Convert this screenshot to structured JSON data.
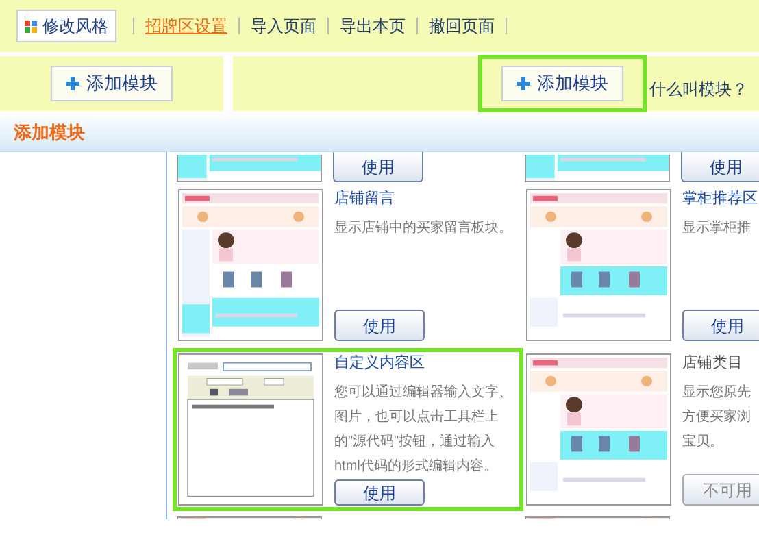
{
  "toolbar": {
    "style_button": "修改风格",
    "links": [
      {
        "label": "招牌区设置",
        "selected": true
      },
      {
        "label": "导入页面",
        "selected": false
      },
      {
        "label": "导出本页",
        "selected": false
      },
      {
        "label": "撤回页面",
        "selected": false
      }
    ]
  },
  "add_bar": {
    "buttons": [
      {
        "label": "添加模块",
        "highlighted": false
      },
      {
        "label": "添加模块",
        "highlighted": true
      }
    ],
    "help_link": "什么叫模块？"
  },
  "section_title": "添加模块",
  "previous_row": [
    {
      "kind": "shop",
      "button": {
        "label": "使用"
      }
    },
    {
      "kind": "shop",
      "button": {
        "label": "使用"
      }
    }
  ],
  "module_rows": [
    [
      {
        "title": "店铺留言",
        "description": [
          "显示店铺中的买家留言板块。"
        ],
        "kind": "shop",
        "highlighted": false,
        "button": {
          "label": "使用",
          "disabled": false
        }
      },
      {
        "title": "掌柜推荐区",
        "description": [
          "显示掌柜推"
        ],
        "kind": "shop",
        "highlighted": false,
        "button": {
          "label": "使用",
          "disabled": false
        }
      }
    ],
    [
      {
        "title": "自定义内容区",
        "description": [
          "您可以通过编辑器输入文字、",
          "图片，也可以点击工具栏上",
          "的\"源代码\"按钮，通过输入",
          "html代码的形式编辑内容。"
        ],
        "kind": "editor",
        "highlighted": true,
        "button": {
          "label": "使用",
          "disabled": false
        }
      },
      {
        "title": "店铺类目",
        "description": [
          "显示您原先",
          "方便买家浏",
          "宝贝。"
        ],
        "kind": "shop",
        "highlighted": false,
        "button": {
          "label": "不可用",
          "disabled": true
        }
      }
    ]
  ]
}
